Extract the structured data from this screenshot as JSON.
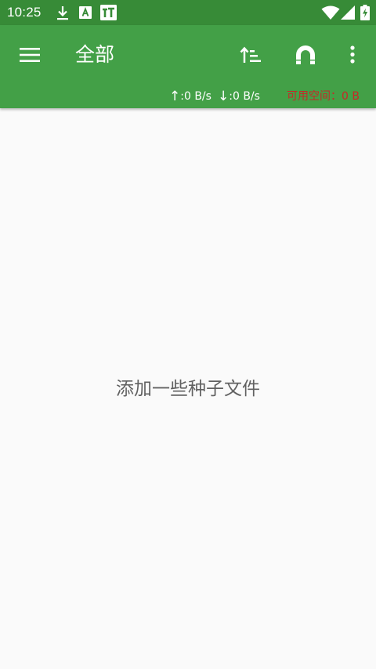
{
  "status_bar": {
    "time": "10:25",
    "icons": [
      "download-icon",
      "text-a-icon",
      "tt-app-icon",
      "wifi-icon",
      "signal-icon",
      "battery-charging-icon"
    ]
  },
  "app_bar": {
    "menu_icon": "hamburger-menu-icon",
    "title": "全部",
    "actions": [
      "sort-icon",
      "magnet-icon",
      "more-vert-icon"
    ],
    "upload_speed": ":0 B/s",
    "download_speed": ":0 B/s",
    "free_space": "可用空间：0 B"
  },
  "main": {
    "empty_message": "添加一些种子文件"
  },
  "colors": {
    "status_bar": "#378b37",
    "app_bar": "#43a047",
    "background": "#fafafa",
    "free_space_text": "#c62828",
    "empty_text": "#616161"
  }
}
